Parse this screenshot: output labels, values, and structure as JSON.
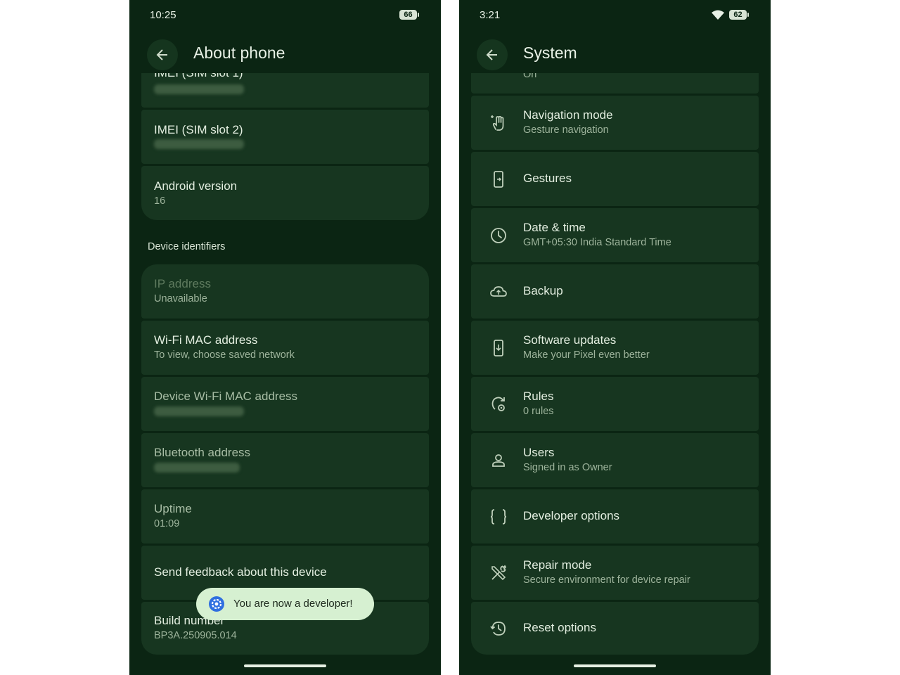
{
  "left": {
    "status_time": "10:25",
    "battery": "66",
    "title": "About phone",
    "partial_top_label": "IMEI (SIM slot 1)",
    "imei2": {
      "title": "IMEI (SIM slot 2)"
    },
    "android": {
      "title": "Android version",
      "value": "16"
    },
    "section_header": "Device identifiers",
    "ip": {
      "title": "IP address",
      "value": "Unavailable"
    },
    "wifi_mac": {
      "title": "Wi-Fi MAC address",
      "value": "To view, choose saved network"
    },
    "device_wifi_mac": {
      "title": "Device Wi-Fi MAC address"
    },
    "bluetooth": {
      "title": "Bluetooth address"
    },
    "uptime": {
      "title": "Uptime",
      "value": "01:09"
    },
    "feedback": {
      "title": "Send feedback about this device"
    },
    "build": {
      "title": "Build number",
      "value": "BP3A.250905.014"
    },
    "toast": "You are now a developer!"
  },
  "right": {
    "status_time": "3:21",
    "battery": "62",
    "title": "System",
    "partial_top_value": "On",
    "items": [
      {
        "title": "Navigation mode",
        "subtitle": "Gesture navigation",
        "icon": "gesture-hand-icon"
      },
      {
        "title": "Gestures",
        "subtitle": "",
        "icon": "phone-gesture-icon"
      },
      {
        "title": "Date & time",
        "subtitle": "GMT+05:30 India Standard Time",
        "icon": "clock-icon"
      },
      {
        "title": "Backup",
        "subtitle": "",
        "icon": "cloud-upload-icon"
      },
      {
        "title": "Software updates",
        "subtitle": "Make your Pixel even better",
        "icon": "system-update-icon"
      },
      {
        "title": "Rules",
        "subtitle": "0 rules",
        "icon": "rules-icon"
      },
      {
        "title": "Users",
        "subtitle": "Signed in as Owner",
        "icon": "person-icon"
      },
      {
        "title": "Developer options",
        "subtitle": "",
        "icon": "code-braces-icon"
      },
      {
        "title": "Repair mode",
        "subtitle": "Secure environment for device repair",
        "icon": "tools-icon"
      },
      {
        "title": "Reset options",
        "subtitle": "",
        "icon": "history-icon"
      }
    ]
  },
  "colors": {
    "background": "#0b2513",
    "card": "#173620",
    "toast": "#d6f0d1",
    "accent_blue": "#2f6fe0"
  }
}
